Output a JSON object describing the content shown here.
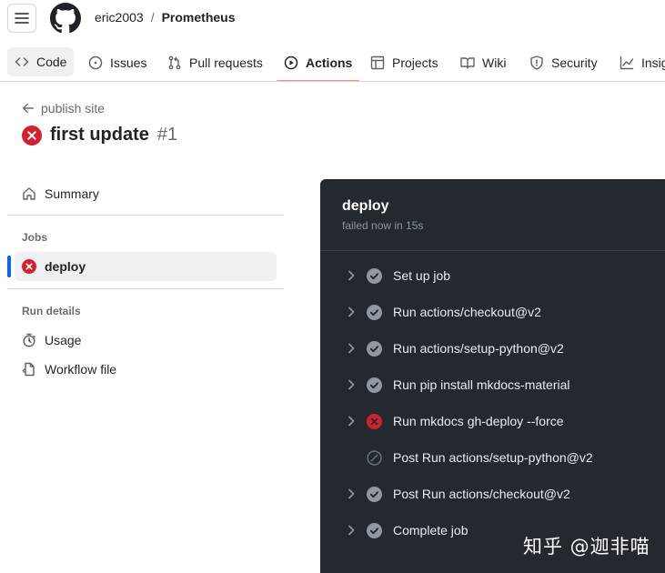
{
  "header": {
    "owner": "eric2003",
    "separator": "/",
    "repo": "Prometheus"
  },
  "tabs": [
    {
      "label": "Code",
      "icon": "code-icon"
    },
    {
      "label": "Issues",
      "icon": "issue-opened-icon"
    },
    {
      "label": "Pull requests",
      "icon": "git-pull-request-icon"
    },
    {
      "label": "Actions",
      "icon": "play-icon",
      "active": true
    },
    {
      "label": "Projects",
      "icon": "table-icon"
    },
    {
      "label": "Wiki",
      "icon": "book-icon"
    },
    {
      "label": "Security",
      "icon": "shield-icon"
    },
    {
      "label": "Insig",
      "icon": "graph-icon"
    }
  ],
  "run": {
    "back_label": "publish site",
    "title": "first update",
    "number": "#1"
  },
  "sidebar": {
    "summary": "Summary",
    "jobs_heading": "Jobs",
    "job": "deploy",
    "run_details_heading": "Run details",
    "usage": "Usage",
    "workflow_file": "Workflow file"
  },
  "job_panel": {
    "title": "deploy",
    "status": "failed now in 15s",
    "steps": [
      {
        "label": "Set up job",
        "status": "success",
        "expandable": true
      },
      {
        "label": "Run actions/checkout@v2",
        "status": "success",
        "expandable": true
      },
      {
        "label": "Run actions/setup-python@v2",
        "status": "success",
        "expandable": true
      },
      {
        "label": "Run pip install mkdocs-material",
        "status": "success",
        "expandable": true
      },
      {
        "label": "Run mkdocs gh-deploy --force",
        "status": "failure",
        "expandable": true
      },
      {
        "label": "Post Run actions/setup-python@v2",
        "status": "skipped",
        "expandable": false
      },
      {
        "label": "Post Run actions/checkout@v2",
        "status": "success",
        "expandable": true
      },
      {
        "label": "Complete job",
        "status": "success",
        "expandable": true
      }
    ]
  },
  "watermark": "知乎 @迦非喵",
  "colors": {
    "failure": "#cf222e",
    "accent": "#0969da",
    "active_tab": "#fd8c73",
    "panel_bg": "#24292f"
  }
}
